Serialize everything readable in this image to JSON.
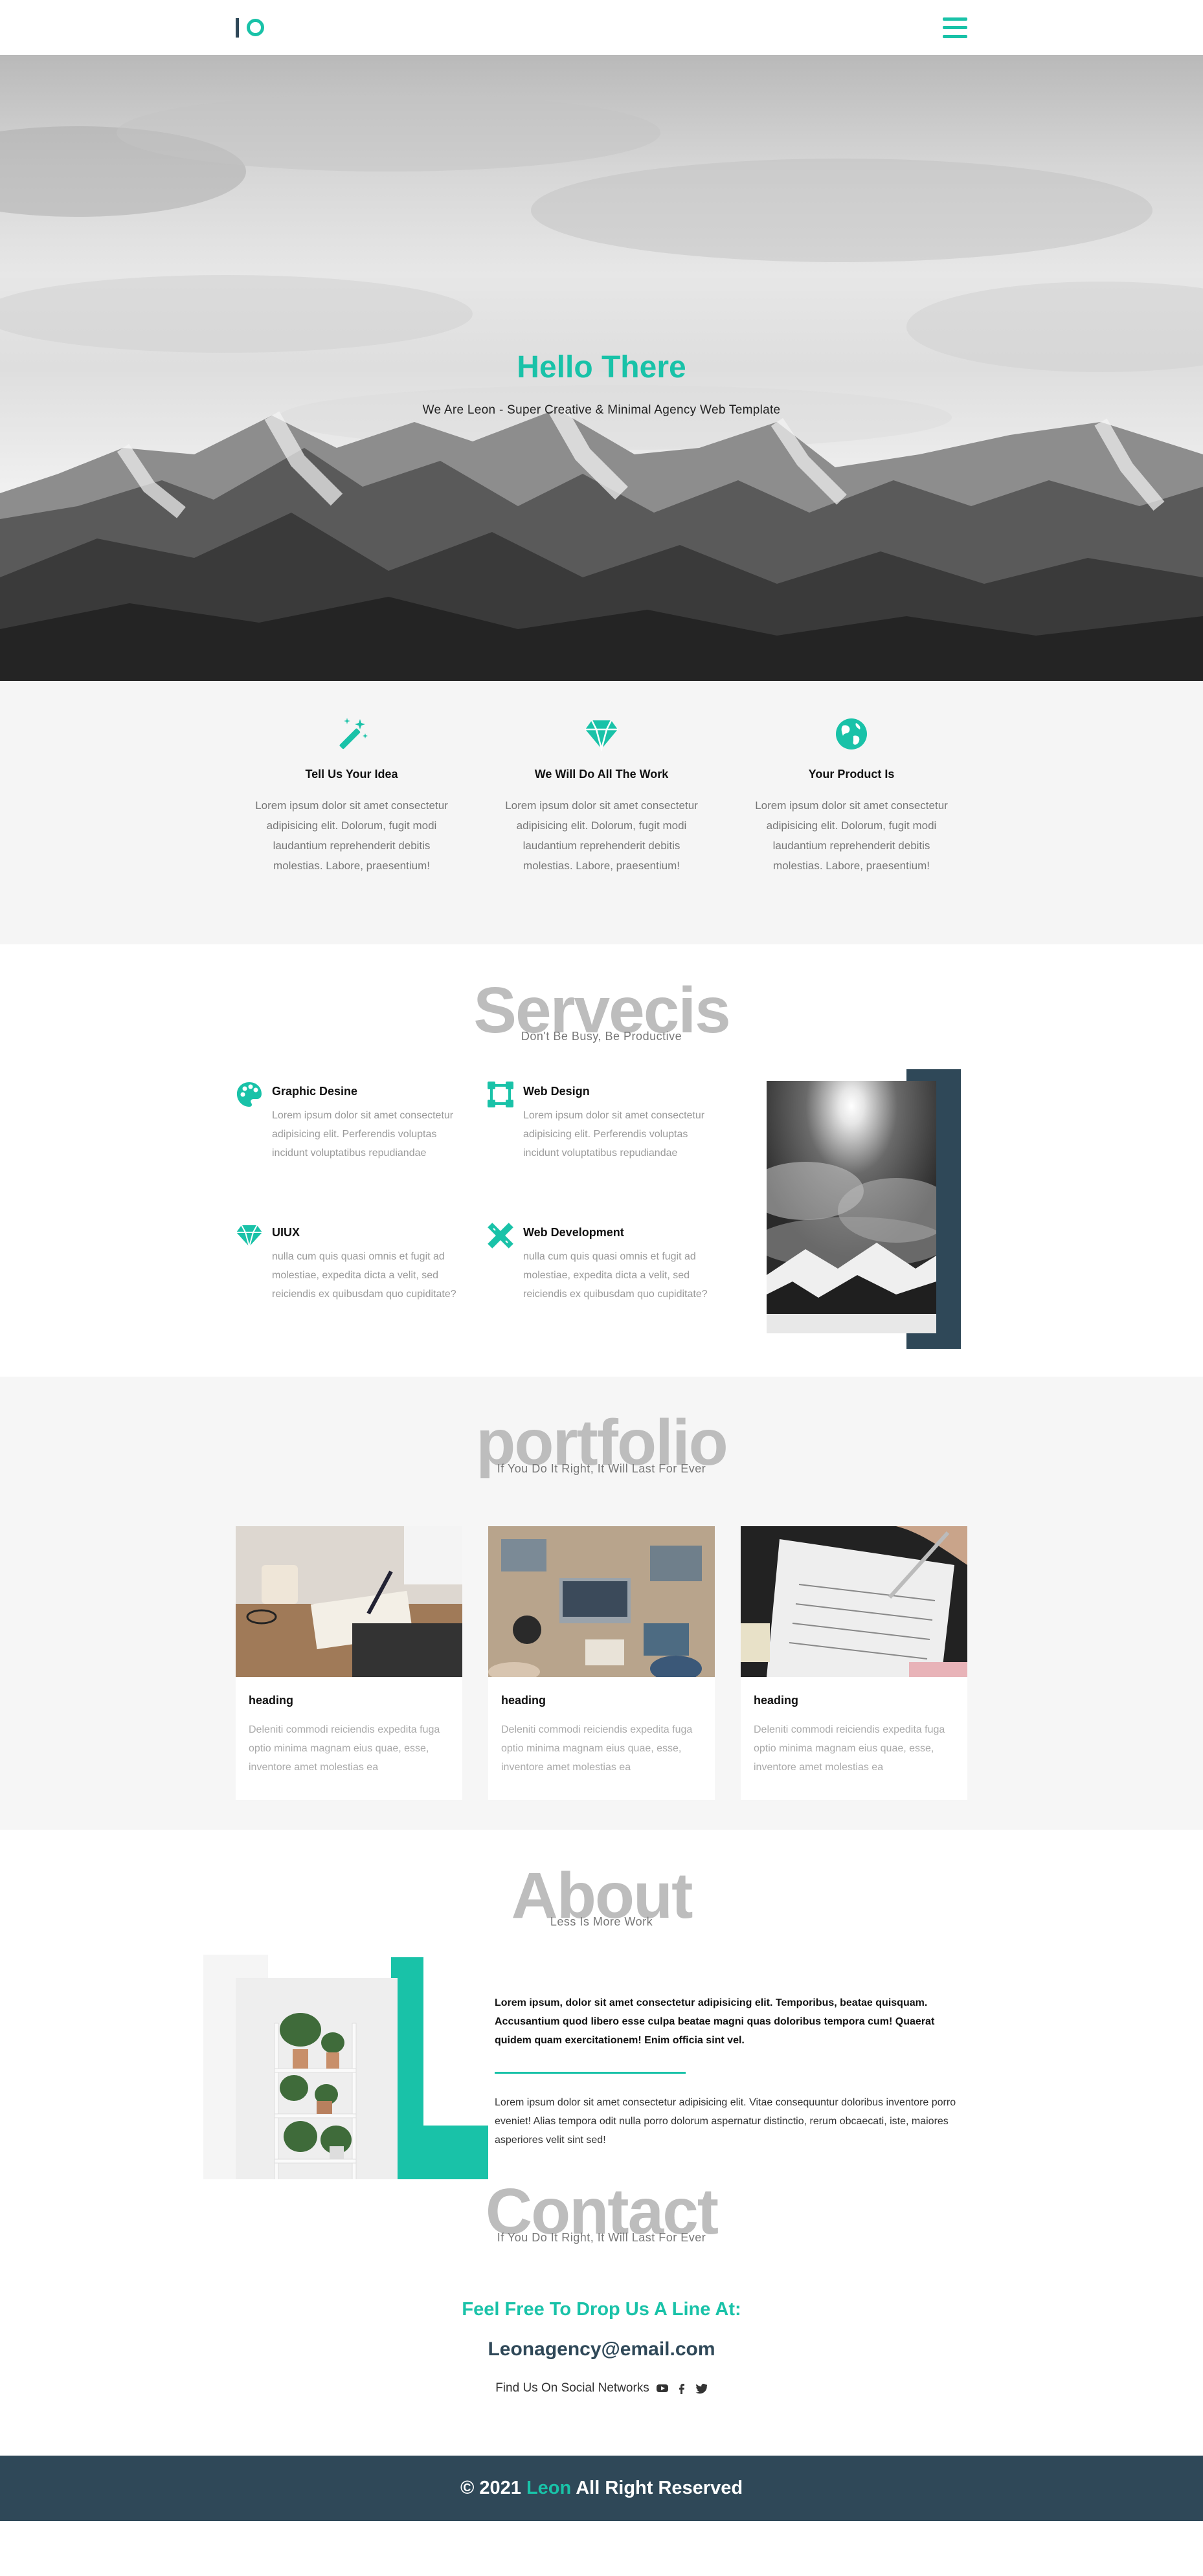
{
  "colors": {
    "accent": "#19c2a8",
    "navy": "#2f4858",
    "grey_text": "#777777"
  },
  "header": {
    "logo_icon": "logo-mark-icon",
    "menu_icon": "hamburger-menu-icon"
  },
  "hero": {
    "title": "Hello There",
    "subtitle": "We Are Leon - Super Creative & Minimal Agency Web Template"
  },
  "features": [
    {
      "icon": "magic-wand-icon",
      "title": "Tell Us Your Idea",
      "text": "Lorem ipsum dolor sit amet consectetur adipisicing elit. Dolorum, fugit modi laudantium reprehenderit debitis molestias. Labore, praesentium!"
    },
    {
      "icon": "diamond-icon",
      "title": "We Will Do All The Work",
      "text": "Lorem ipsum dolor sit amet consectetur adipisicing elit. Dolorum, fugit modi laudantium reprehenderit debitis molestias. Labore, praesentium!"
    },
    {
      "icon": "globe-icon",
      "title": "Your Product Is",
      "text": "Lorem ipsum dolor sit amet consectetur adipisicing elit. Dolorum, fugit modi laudantium reprehenderit debitis molestias. Labore, praesentium!"
    }
  ],
  "services": {
    "title": "Servecis",
    "subtitle": "Don't Be Busy, Be Productive",
    "items": [
      {
        "icon": "palette-icon",
        "title": "Graphic Desine",
        "text": "Lorem ipsum dolor sit amet consectetur adipisicing elit. Perferendis voluptas incidunt voluptatibus repudiandae"
      },
      {
        "icon": "vector-square-icon",
        "title": "Web Design",
        "text": "Lorem ipsum dolor sit amet consectetur adipisicing elit. Perferendis voluptas incidunt voluptatibus repudiandae"
      },
      {
        "icon": "diamond-icon",
        "title": "UIUX",
        "text": "nulla cum quis quasi omnis et fugit ad molestiae, expedita dicta a velit, sed reiciendis ex quibusdam quo cupiditate?"
      },
      {
        "icon": "pencil-ruler-icon",
        "title": "Web Development",
        "text": "nulla cum quis quasi omnis et fugit ad molestiae, expedita dicta a velit, sed reiciendis ex quibusdam quo cupiditate?"
      }
    ]
  },
  "portfolio": {
    "title": "portfolio",
    "subtitle": "If You Do It Right, It Will Last For Ever",
    "cards": [
      {
        "heading": "heading",
        "text": "Deleniti commodi reiciendis expedita fuga optio minima magnam eius quae, esse, inventore amet molestias ea"
      },
      {
        "heading": "heading",
        "text": "Deleniti commodi reiciendis expedita fuga optio minima magnam eius quae, esse, inventore amet molestias ea"
      },
      {
        "heading": "heading",
        "text": "Deleniti commodi reiciendis expedita fuga optio minima magnam eius quae, esse, inventore amet molestias ea"
      }
    ]
  },
  "about": {
    "title": "About",
    "subtitle": "Less Is More Work",
    "bold_text": "Lorem ipsum, dolor sit amet consectetur adipisicing elit. Temporibus, beatae quisquam. Accusantium quod libero esse culpa beatae magni quas doloribus tempora cum! Quaerat quidem quam exercitationem! Enim officia sint vel.",
    "text": "Lorem ipsum dolor sit amet consectetur adipisicing elit. Vitae consequuntur doloribus inventore porro eveniet! Alias tempora odit nulla porro dolorum aspernatur distinctio, rerum obcaecati, iste, maiores asperiores velit sint sed!"
  },
  "contact": {
    "title": "Contact",
    "subtitle": "If You Do It Right, It Will Last For Ever",
    "drop_line": "Feel Free To Drop Us A Line At:",
    "email": "Leonagency@email.com",
    "social_label": "Find Us On Social Networks",
    "social_icons": [
      "youtube-icon",
      "facebook-icon",
      "twitter-icon"
    ]
  },
  "footer": {
    "prefix": "© 2021",
    "brand": "Leon",
    "suffix": "All Right Reserved"
  }
}
